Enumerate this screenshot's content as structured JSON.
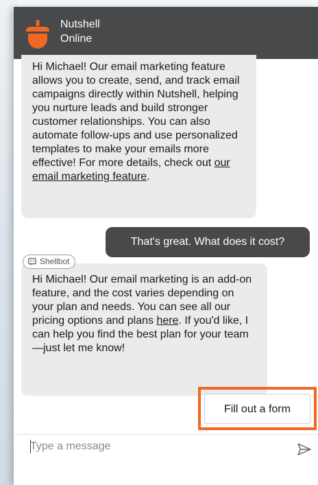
{
  "header": {
    "name": "Nutshell",
    "status": "Online",
    "logo_icon": "nutshell-acorn-logo",
    "background": "#48494a",
    "accent": "#f26722"
  },
  "messages": {
    "bot_message_1": {
      "text_before_link": "Hi Michael! Our email marketing feature allows you to create, send, and track email campaigns directly within Nutshell, helping you nurture leads and build stronger customer relationships. You can also automate follow-ups and use personalized templates to make your emails more effective! For more details, check out ",
      "link": "our email marketing feature",
      "text_after_link": "."
    },
    "user_message_1": "That's great. What does it cost?",
    "bot_tag": {
      "icon": "chatbot-icon",
      "label": "Shellbot"
    },
    "bot_message_2": {
      "text_before_link": "Hi Michael! Our email marketing is an add-on feature, and the cost varies depending on your plan and needs. You can see all our pricing options and plans ",
      "link": "here",
      "text_after_link": ". If you'd like, I can help you find the best plan for your team—just let me know!"
    },
    "quick_reply": "Fill out a form",
    "highlight_color": "#f26722"
  },
  "composer": {
    "placeholder": "Type a message",
    "value": "",
    "send_icon": "send-icon"
  }
}
